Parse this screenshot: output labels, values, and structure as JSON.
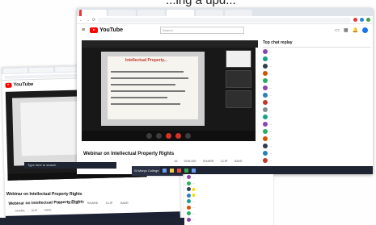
{
  "top_title": "...ing a upd...",
  "back": {
    "tabs": [
      "",
      "",
      "",
      ""
    ],
    "address": "",
    "logo": "YouTube",
    "video_title": "Webinar on Intellectual Property Rights",
    "meta": [
      "",
      "SHARE",
      "CLIP",
      "SAVE"
    ]
  },
  "front": {
    "tabs": [
      "",
      "",
      "",
      "",
      "",
      ""
    ],
    "address": "",
    "logo": "YouTube",
    "search_placeholder": "Search",
    "player_title": "",
    "slide_title": "Intellectual Property...",
    "video_title": "Webinar on Intellectual Property Rights",
    "meta": [
      "15",
      "DISLIKE",
      "SHARE",
      "CLIP",
      "SAVE"
    ],
    "channel": "St Marys College Thrissur",
    "chat_header": "Top chat replay",
    "chat_messages": [
      {
        "text": "...",
        "color": "#8e44ad"
      },
      {
        "text": "...",
        "color": "#16a085"
      },
      {
        "text": "...",
        "color": "#2c3e50"
      },
      {
        "text": "...",
        "color": "#d35400"
      },
      {
        "text": "...",
        "color": "#27ae60"
      },
      {
        "text": "...",
        "color": "#8e44ad"
      },
      {
        "text": "...",
        "color": "#2980b9"
      },
      {
        "text": "...",
        "color": "#c0392b"
      },
      {
        "text": "...",
        "color": "#7f8c8d"
      },
      {
        "text": "...",
        "color": "#16a085"
      },
      {
        "text": "...",
        "color": "#8e44ad"
      },
      {
        "text": "...",
        "color": "#27ae60"
      },
      {
        "text": "...",
        "color": "#d35400"
      },
      {
        "text": "...",
        "color": "#2c3e50"
      },
      {
        "text": "...",
        "color": "#2980b9"
      },
      {
        "text": "...",
        "color": "#c0392b"
      }
    ]
  },
  "taskbar": {
    "time": ""
  },
  "lower": {
    "search": "Type here to search",
    "channel": "St Marys College Thrissur",
    "title": "Webinar on Intellectual Property Rights",
    "meta": [
      "15",
      "DISLIKE",
      "SHARE",
      "CLIP",
      "SAVE"
    ]
  },
  "chatstrip": [
    {
      "text": "...",
      "color": "#8e44ad",
      "hl": false
    },
    {
      "text": "...",
      "color": "#27ae60",
      "hl": false
    },
    {
      "text": "...",
      "color": "#2c3e50",
      "hl": true
    },
    {
      "text": "...",
      "color": "#2980b9",
      "hl": true
    },
    {
      "text": "...",
      "color": "#16a085",
      "hl": false
    },
    {
      "text": "...",
      "color": "#d35400",
      "hl": false
    },
    {
      "text": "...",
      "color": "#27ae60",
      "hl": false
    },
    {
      "text": "...",
      "color": "#8e44ad",
      "hl": false
    }
  ]
}
